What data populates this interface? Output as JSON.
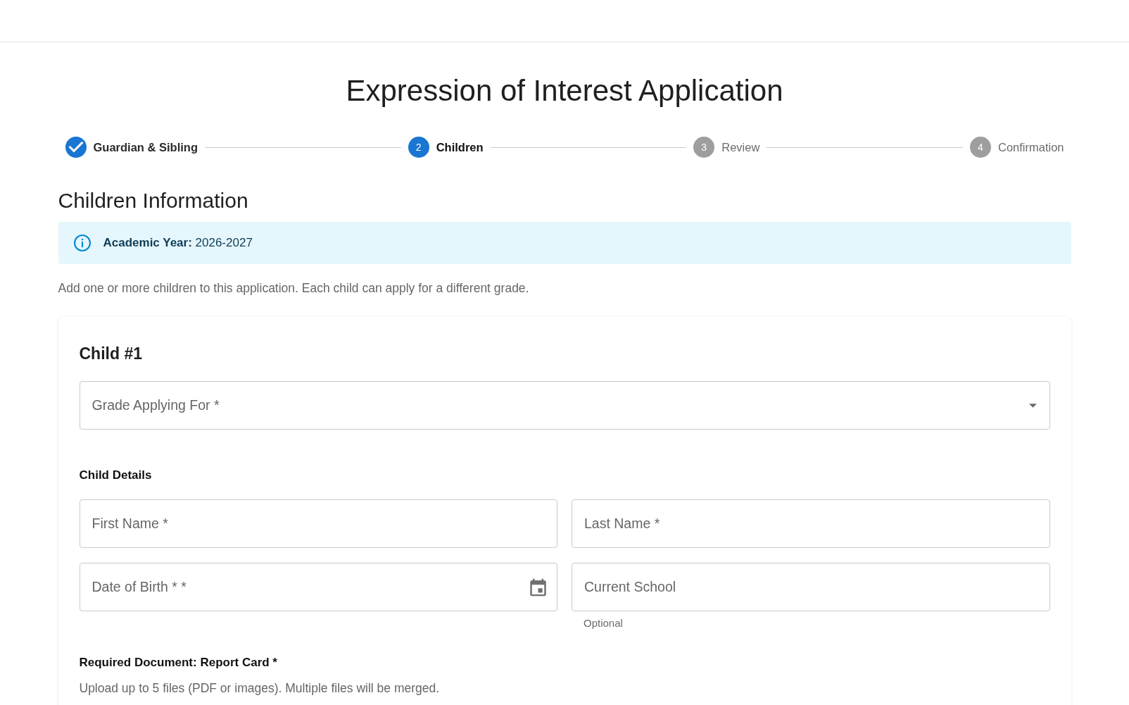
{
  "page": {
    "title": "Expression of Interest Application"
  },
  "stepper": {
    "steps": [
      {
        "label": "Guardian & Sibling",
        "completed": true,
        "selected": false
      },
      {
        "label": "Children",
        "number": "2",
        "completed": false,
        "selected": true
      },
      {
        "label": "Review",
        "number": "3",
        "completed": false,
        "selected": false
      },
      {
        "label": "Confirmation",
        "number": "4",
        "completed": false,
        "selected": false
      }
    ]
  },
  "section": {
    "title": "Children Information",
    "info_banner": {
      "text": "**Academic Year:** 2026-2027"
    },
    "description": "Add one or more children to this application. Each child can apply for a different grade."
  },
  "child_card": {
    "title": "Child #1",
    "grade_select": {
      "placeholder": "Grade Applying For *"
    },
    "details_heading": "Child Details",
    "fields": [
      {
        "kind": "text",
        "placeholder": "First Name *"
      },
      {
        "kind": "text",
        "placeholder": "Last Name *"
      },
      {
        "kind": "date",
        "placeholder": "Date of Birth * *"
      },
      {
        "kind": "text",
        "placeholder": "Current School",
        "helper": "Optional"
      }
    ],
    "document": {
      "heading": "Required Document: Report Card *",
      "hint": "Upload up to 5 files (PDF or images). Multiple files will be merged."
    }
  }
}
